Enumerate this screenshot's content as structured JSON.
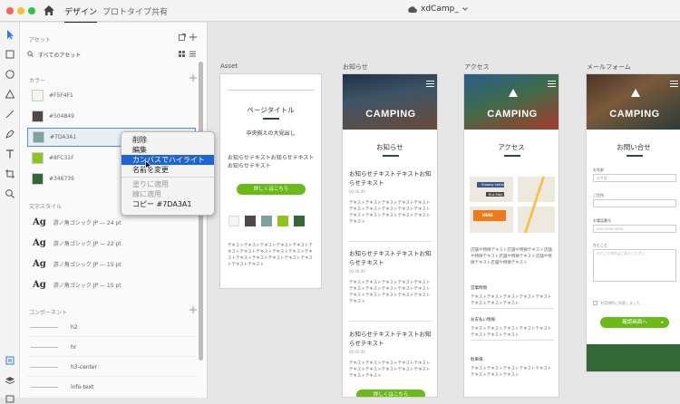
{
  "titlebar": {
    "tabs": [
      {
        "label": "デザイン"
      },
      {
        "label": "プロトタイプ"
      },
      {
        "label": "共有"
      }
    ],
    "document_title": "xdCamp_"
  },
  "panel": {
    "assets_heading": "アセット",
    "asset_filter": "すべてのアセット",
    "colors_heading": "カラー",
    "colors": [
      {
        "hex": "#F5F4F1"
      },
      {
        "hex": "#504849"
      },
      {
        "hex": "#7DA3A1"
      },
      {
        "hex": "#8FC31F"
      },
      {
        "hex": "#346736"
      }
    ],
    "char_styles_heading": "文字スタイル",
    "char_styles": [
      {
        "ag": "Ag",
        "font": "游ノ角ゴシック JP — 24 pt"
      },
      {
        "ag": "Ag",
        "font": "游ノ角ゴシック JP — 22 pt"
      },
      {
        "ag": "Ag",
        "font": "游ノ角ゴシック JP — 15 pt"
      },
      {
        "ag": "Ag",
        "font": "游ノ角ゴシック JP — 15 pt"
      }
    ],
    "components_heading": "コンポーネント",
    "components": [
      {
        "label": "h2"
      },
      {
        "label": "hr"
      },
      {
        "label": "h3-center"
      },
      {
        "label": "info-text"
      }
    ]
  },
  "context_menu": {
    "items": [
      {
        "label": "削除",
        "state": "normal"
      },
      {
        "label": "編集",
        "state": "normal"
      },
      {
        "label": "カンバスでハイライト",
        "state": "selected"
      },
      {
        "label": "名前を変更",
        "state": "normal"
      },
      {
        "label": "塗りに適用",
        "state": "disabled"
      },
      {
        "label": "線に適用",
        "state": "disabled"
      },
      {
        "label": "コピー #7DA3A1",
        "state": "normal"
      }
    ]
  },
  "artboards": {
    "asset": {
      "label": "Asset",
      "page_title": "ページタイトル",
      "center_heading": "中央揃えの大見出し",
      "info_text": "お知らせテキストお知らせテキストお知らせテキスト",
      "button": "詳しくはこちら",
      "body": "テキストテキストテキストテキストテキストテキストテキストテキストテキストテキストテキストテキストテキストテキストテキストテキストテキストテキスト"
    },
    "news": {
      "label": "お知らせ",
      "hero_title": "CAMPING",
      "heading": "お知らせ",
      "items": [
        {
          "title": "お知らせテキストテキストお知らせテキスト",
          "date": "00.00.00",
          "body": "テキストテキストテキストテキストテキストテキストテキストテキストテキストテキストテキストテキストテキストテキストテキストテキスト"
        },
        {
          "title": "お知らせテキストテキストお知らせテキスト",
          "date": "00.00.00",
          "body": "テキストテキストテキストテキストテキストテキストテキストテキストテキストテキストテキストテキストテキストテキストテキストテキスト"
        },
        {
          "title": "お知らせテキストテキストお知らせテキスト",
          "date": "00.00.00",
          "body": "テキストテキストテキストテキストテキストテキストテキストテキストテキストテキストテキストテキスト"
        }
      ],
      "button": "詳しくはこちら"
    },
    "access": {
      "label": "アクセス",
      "hero_title": "CAMPING",
      "heading": "アクセス",
      "map_labels": {
        "station": "Subway station",
        "bus": "Bus Stop",
        "here": "HERE"
      },
      "desc": "店舗や特徴テキスト店舗や特徴テキスト店舗や特徴テキスト店舗や特徴テキスト店舗や特徴テキスト店舗や特徴テキスト",
      "sections": [
        {
          "title": "営業時間",
          "body": "テキストテキストテキストテキストテキストテキストテキストテキスト"
        },
        {
          "title": "お支払い情報",
          "body": "テキストテキストテキストテキストテキストテキストテキストテキスト"
        },
        {
          "title": "駐車場",
          "body": "テキストテキストテキストテキストテキストテキストテキストテキスト"
        }
      ]
    },
    "form": {
      "label": "メールフォーム",
      "hero_title": "CAMPING",
      "heading": "お問い合せ",
      "fields": [
        {
          "label": "お名前",
          "placeholder": "お名前"
        },
        {
          "label": "ご住所",
          "placeholder": ""
        },
        {
          "label": "お電話番号",
          "placeholder": "000-0000-0000"
        },
        {
          "label": "ひとこと",
          "placeholder": "ひとことあればご記入ください"
        }
      ],
      "consent": "利用規約に同意しました",
      "button": "確認画面へ"
    }
  }
}
